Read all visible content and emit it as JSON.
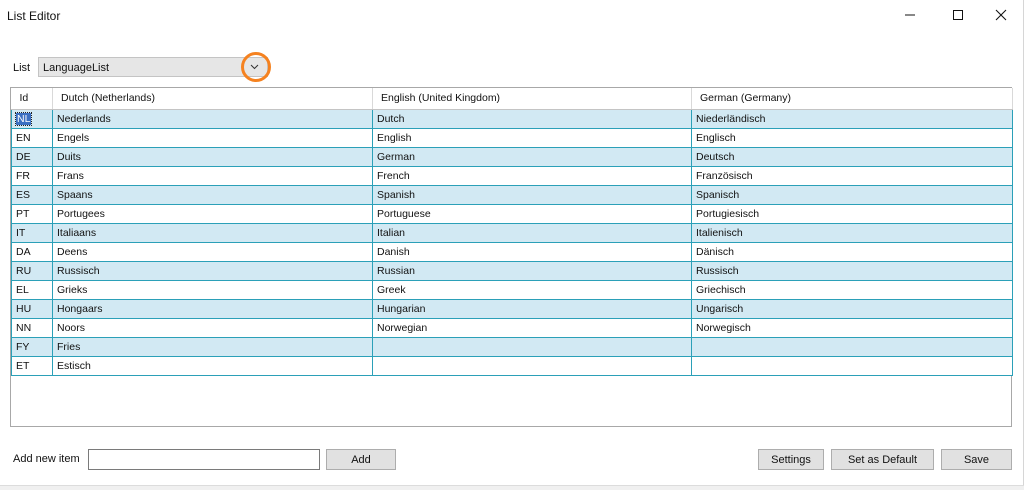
{
  "window": {
    "title": "List Editor",
    "controls": {
      "minimize": "minimize-icon",
      "maximize": "maximize-icon",
      "close": "close-icon"
    }
  },
  "list_selector": {
    "label": "List",
    "value": "LanguageList",
    "icon": "chevron-down-icon",
    "highlight_color": "#f58220"
  },
  "grid": {
    "columns": [
      "Id",
      "Dutch (Netherlands)",
      "English (United Kingdom)",
      "German (Germany)"
    ],
    "selected_row": 0,
    "rows": [
      [
        "NL",
        "Nederlands",
        "Dutch",
        "Niederländisch"
      ],
      [
        "EN",
        "Engels",
        "English",
        "Englisch"
      ],
      [
        "DE",
        "Duits",
        "German",
        "Deutsch"
      ],
      [
        "FR",
        "Frans",
        "French",
        "Französisch"
      ],
      [
        "ES",
        "Spaans",
        "Spanish",
        "Spanisch"
      ],
      [
        "PT",
        "Portugees",
        "Portuguese",
        "Portugiesisch"
      ],
      [
        "IT",
        "Italiaans",
        "Italian",
        "Italienisch"
      ],
      [
        "DA",
        "Deens",
        "Danish",
        "Dänisch"
      ],
      [
        "RU",
        "Russisch",
        "Russian",
        "Russisch"
      ],
      [
        "EL",
        "Grieks",
        "Greek",
        "Griechisch"
      ],
      [
        "HU",
        "Hongaars",
        "Hungarian",
        "Ungarisch"
      ],
      [
        "NN",
        "Noors",
        "Norwegian",
        "Norwegisch"
      ],
      [
        "FY",
        "Fries",
        "",
        ""
      ],
      [
        "ET",
        "Estisch",
        "",
        ""
      ]
    ],
    "row_colors": {
      "odd": "#d2e9f3",
      "even": "#ffffff",
      "border": "#2ba0b8"
    }
  },
  "footer": {
    "add_label": "Add new item",
    "add_value": "",
    "add_button": "Add",
    "settings_button": "Settings",
    "default_button": "Set as Default",
    "save_button": "Save"
  }
}
